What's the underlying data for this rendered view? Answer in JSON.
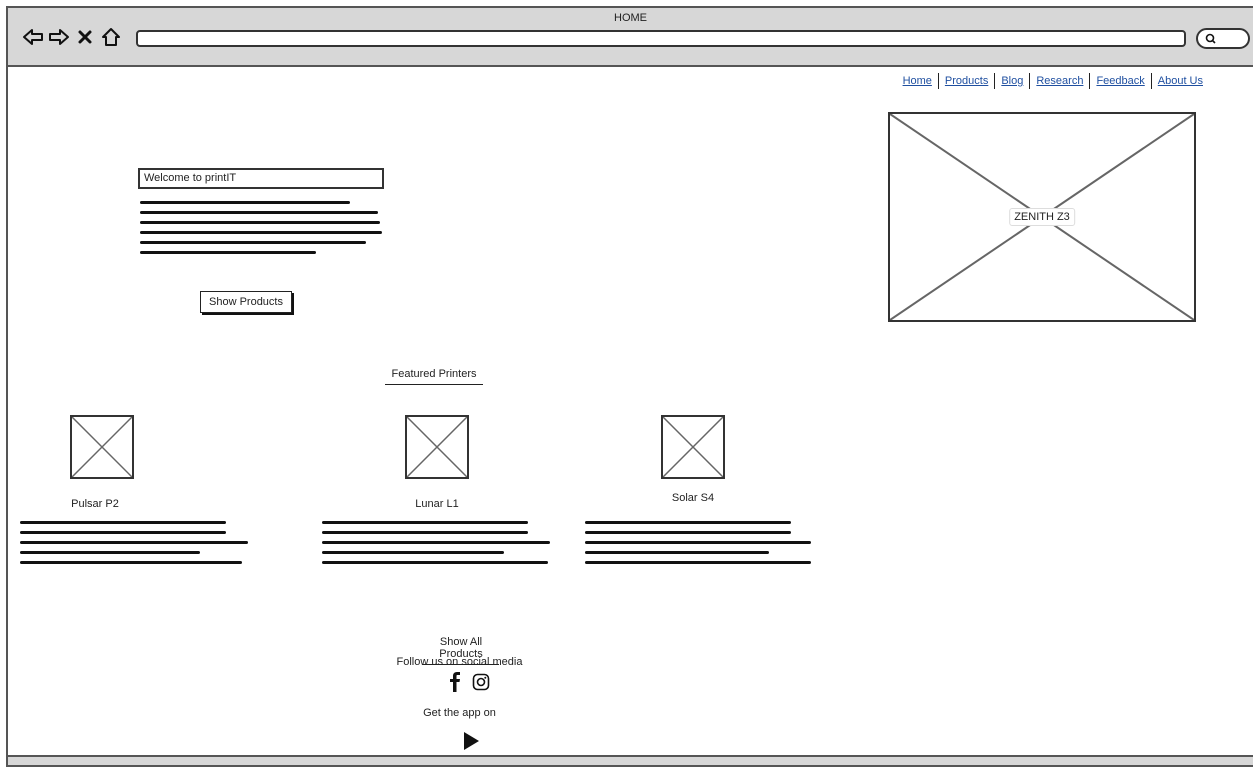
{
  "browser": {
    "title": "HOME"
  },
  "nav": {
    "items": [
      {
        "label": "Home"
      },
      {
        "label": "Products"
      },
      {
        "label": "Blog"
      },
      {
        "label": "Research"
      },
      {
        "label": "Feedback"
      },
      {
        "label": "About Us"
      }
    ]
  },
  "hero": {
    "welcome": "Welcome to printIT",
    "show_products_label": "Show Products",
    "image_caption": "ZENITH Z3"
  },
  "featured": {
    "title": "Featured Printers",
    "products": [
      {
        "name": "Pulsar P2"
      },
      {
        "name": "Lunar L1"
      },
      {
        "name": "Solar S4"
      }
    ],
    "show_all_label": "Show All Products"
  },
  "footer": {
    "follow_text": "Follow us on social media",
    "social_icons": [
      "facebook-icon",
      "instagram-icon"
    ],
    "app_text": "Get the app on",
    "app_icon": "play-store-icon"
  }
}
